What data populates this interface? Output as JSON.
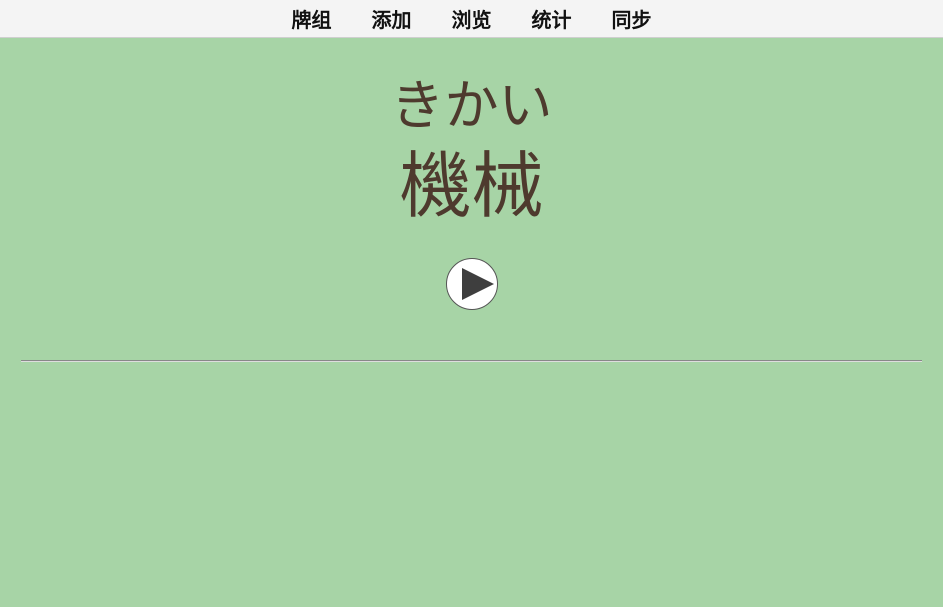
{
  "nav": {
    "items": [
      {
        "label": "牌组"
      },
      {
        "label": "添加"
      },
      {
        "label": "浏览"
      },
      {
        "label": "统计"
      },
      {
        "label": "同步"
      }
    ]
  },
  "card": {
    "reading": "きかい",
    "word": "機械",
    "audio_icon": "play-icon"
  },
  "colors": {
    "background": "#a7d4a6",
    "text": "#4e3a2e"
  }
}
